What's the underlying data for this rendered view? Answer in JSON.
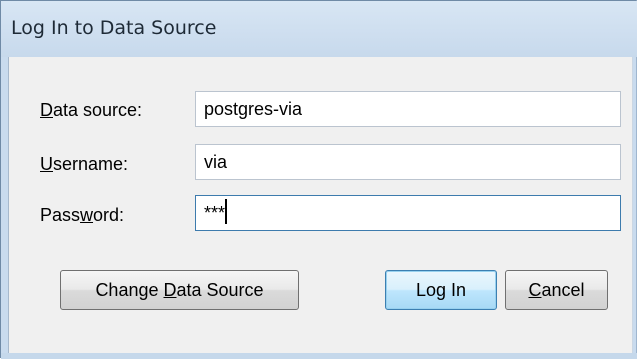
{
  "window": {
    "title": "Log In to Data Source"
  },
  "form": {
    "data_source": {
      "label_prefix": "",
      "label_mnemonic": "D",
      "label_rest": "ata source:",
      "value": "postgres-via"
    },
    "username": {
      "label_prefix": "",
      "label_mnemonic": "U",
      "label_rest": "sername:",
      "value": "via"
    },
    "password": {
      "label_prefix": "Pass",
      "label_mnemonic": "w",
      "label_rest": "ord:",
      "value": "***"
    }
  },
  "buttons": {
    "change_data_source": {
      "prefix": "Change ",
      "mnemonic": "D",
      "rest": "ata Source"
    },
    "log_in": {
      "label": "Log In"
    },
    "cancel": {
      "prefix": "",
      "mnemonic": "C",
      "rest": "ancel"
    }
  },
  "colors": {
    "title_bar": "#c9dbee",
    "client_bg": "#f0f0f0",
    "default_button_border": "#3c7fb1",
    "focused_input_border": "#3d7bad"
  }
}
